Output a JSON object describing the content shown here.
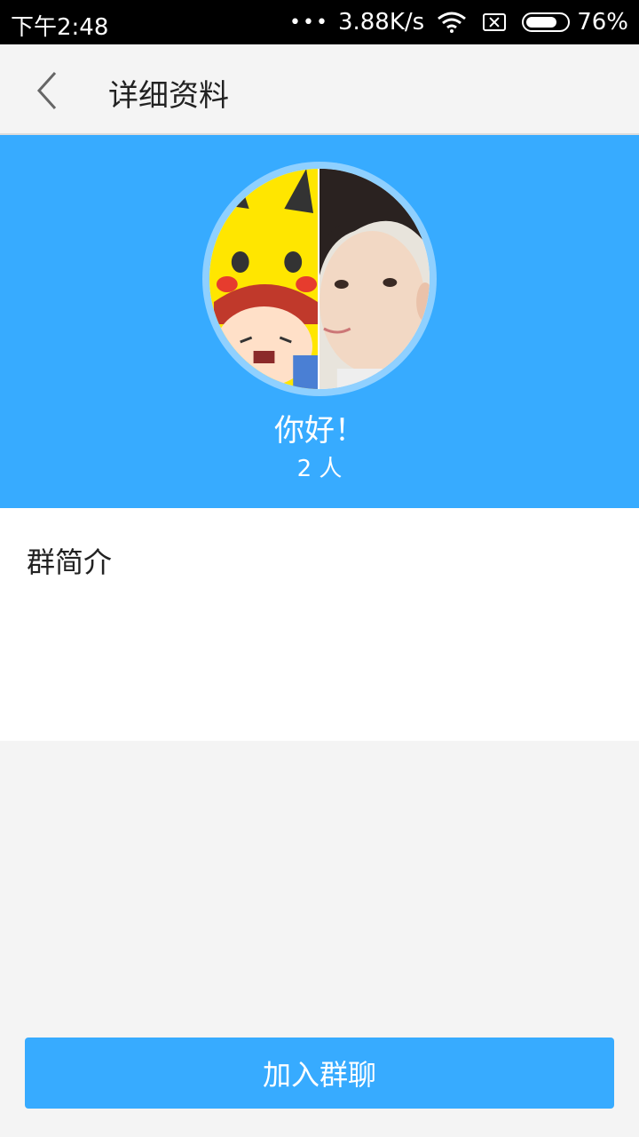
{
  "status_bar": {
    "time": "下午2:48",
    "dots": "•••",
    "speed": "3.88K/s",
    "battery": "76%",
    "battery_level": 0.76,
    "icons": [
      "wifi-icon",
      "sim-blocked-icon",
      "battery-icon"
    ]
  },
  "app_bar": {
    "back_icon": "chevron-left-icon",
    "title": "详细资料"
  },
  "group": {
    "name": "你好！",
    "member_count": "2 人"
  },
  "intro": {
    "title": "群简介"
  },
  "join_button_label": "加入群聊",
  "colors": {
    "accent": "#37abff",
    "avatar_ring": "#8fd0ff",
    "background": "#f4f4f4"
  }
}
